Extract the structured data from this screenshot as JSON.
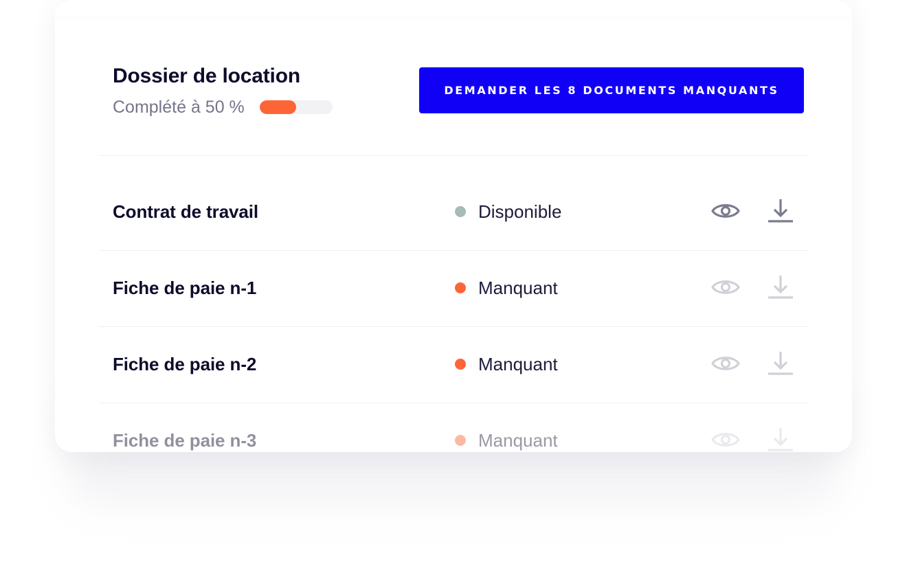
{
  "card": {
    "title": "Dossier de location",
    "progress_label": "Complété à 50 %",
    "progress_value": 0.5,
    "cta_label": "DEMANDER LES 8 DOCUMENTS MANQUANTS"
  },
  "colors": {
    "accent": "#1100f6",
    "progress": "#fd6537",
    "missing": "#fd6537",
    "available": "#a6bab8",
    "icon_active": "#7a7b8e",
    "icon_disabled": "#c9c9d2"
  },
  "documents": [
    {
      "name": "Contrat de travail",
      "status": "Disponible",
      "status_color": "#a6bab8",
      "actions": [
        "eye-icon",
        "download-icon"
      ],
      "actions_enabled": true
    },
    {
      "name": "Fiche de paie n-1",
      "status": "Manquant",
      "status_color": "#fd6537",
      "actions": [
        "eye-icon",
        "download-icon"
      ],
      "actions_enabled": false
    },
    {
      "name": "Fiche de paie n-2",
      "status": "Manquant",
      "status_color": "#fd6537",
      "actions": [
        "eye-icon",
        "download-icon"
      ],
      "actions_enabled": false
    },
    {
      "name": "Fiche de paie n-3",
      "status": "Manquant",
      "status_color": "#fd6537",
      "actions": [
        "eye-icon",
        "download-icon"
      ],
      "actions_enabled": false
    }
  ]
}
